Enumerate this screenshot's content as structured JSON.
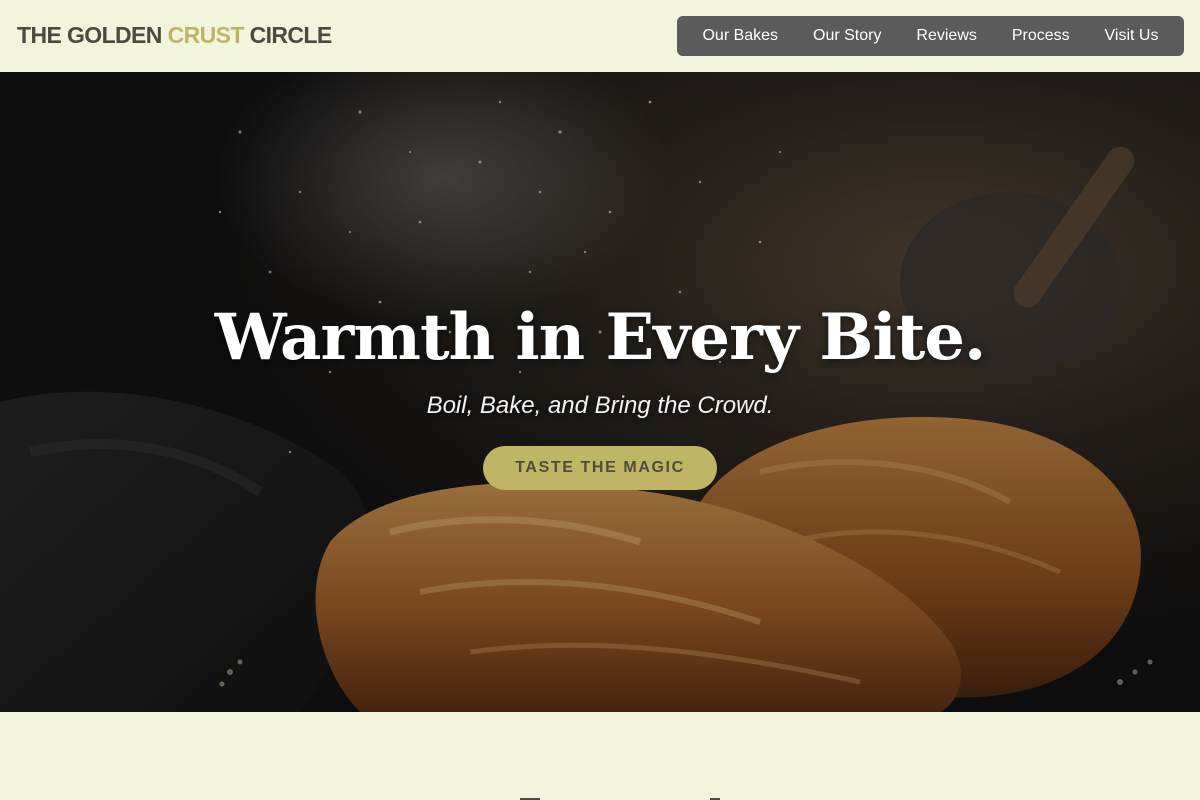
{
  "brand": {
    "part1": "THE GOLDEN ",
    "accent": "CRUST",
    "part2": " CIRCLE"
  },
  "nav": {
    "items": [
      {
        "label": "Our Bakes"
      },
      {
        "label": "Our Story"
      },
      {
        "label": "Reviews"
      },
      {
        "label": "Process"
      },
      {
        "label": "Visit Us"
      }
    ]
  },
  "hero": {
    "title": "Warmth in Every Bite.",
    "subtitle": "Boil, Bake, and Bring the Crowd.",
    "cta_label": "TASTE THE MAGIC",
    "background_icon": "croissants-photo"
  },
  "colors": {
    "background": "#f3f4dc",
    "accent": "#bfb565",
    "nav_background": "#5b5b5b",
    "brand_text": "#4a4a40"
  }
}
